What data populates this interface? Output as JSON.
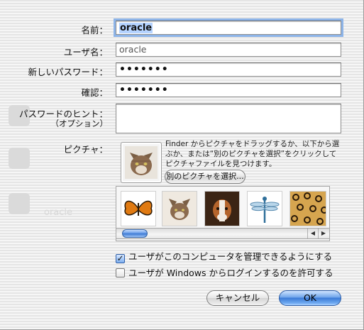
{
  "form": {
    "name_label": "名前：",
    "name_value": "oracle",
    "username_label": "ユーザ名：",
    "username_value": "oracle",
    "password_label": "新しいパスワード：",
    "password_value": "•••••••",
    "confirm_label": "確認：",
    "confirm_value": "•••••••",
    "hint_label": "パスワードのヒント：",
    "hint_sublabel": "（オプション）",
    "hint_value": ""
  },
  "picture": {
    "label": "ピクチャ：",
    "instructions": "Finder からピクチャをドラッグするか、以下から選ぶか、または“別のピクチャを選択”をクリックしてピクチャファイルを見つけます。",
    "choose_button": "別のピクチャを選択...",
    "thumbnails": [
      "butterfly",
      "cat",
      "dog",
      "dragonfly",
      "leopard"
    ]
  },
  "options": {
    "admin_label": "ユーザがこのコンピュータを管理できるようにする",
    "admin_checked": true,
    "windows_label": "ユーザが Windows からログインするのを許可する",
    "windows_checked": false
  },
  "buttons": {
    "cancel": "キャンセル",
    "ok": "OK"
  },
  "background": {
    "ghost_text": "oracle"
  },
  "colors": {
    "focus_ring": "#8db4e8",
    "selection": "#b5d3ff",
    "default_button": "#3b7ad6"
  }
}
